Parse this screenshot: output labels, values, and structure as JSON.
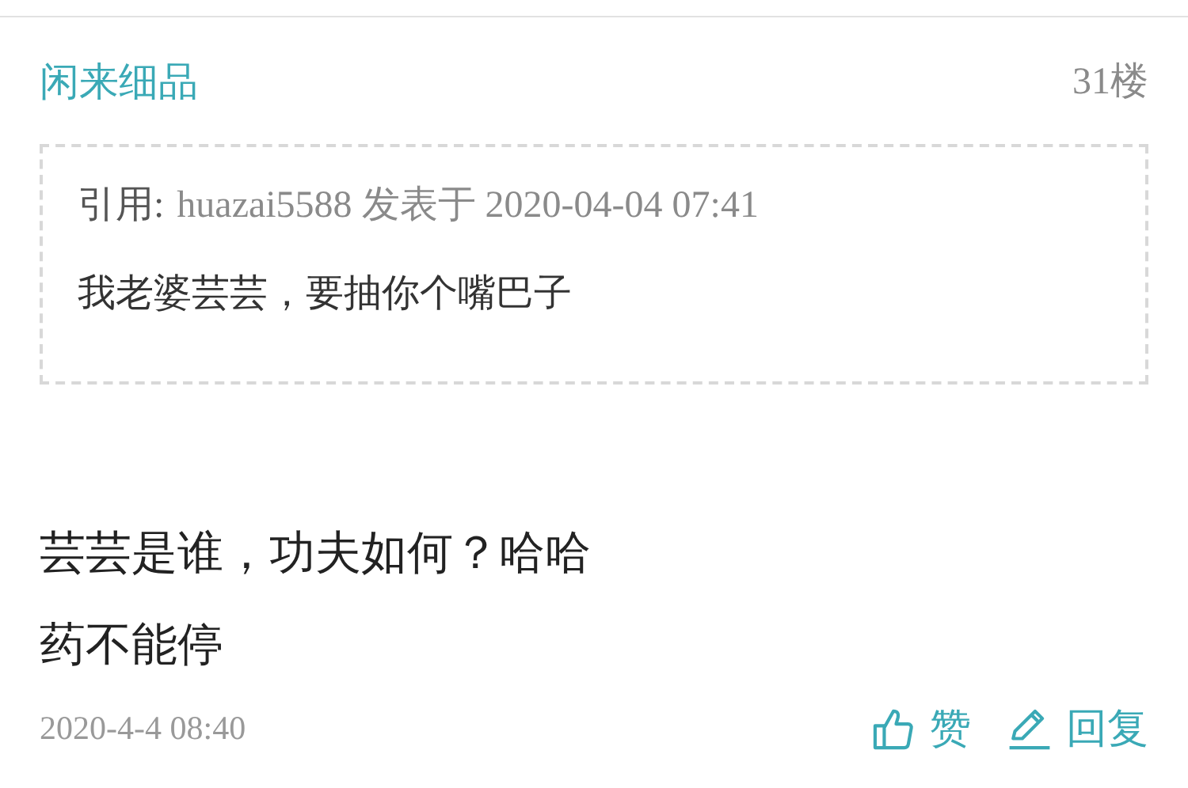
{
  "post": {
    "author": "闲来细品",
    "floor": "31楼",
    "quote": {
      "label": "引用:",
      "meta": "huazai5588 发表于 2020-04-04 07:41",
      "text": "我老婆芸芸，要抽你个嘴巴子"
    },
    "lines": [
      "芸芸是谁，功夫如何？哈哈",
      "药不能停"
    ],
    "time": "2020-4-4 08:40",
    "actions": [
      {
        "kind": "like",
        "label": "赞"
      },
      {
        "kind": "reply",
        "label": "回复"
      }
    ]
  }
}
